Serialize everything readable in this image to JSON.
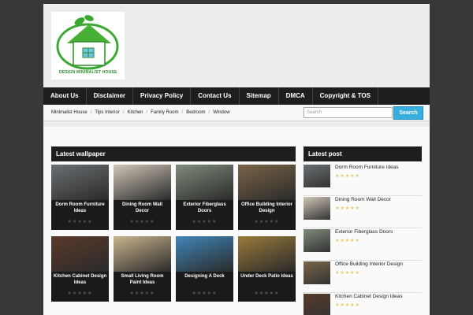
{
  "logo": {
    "text": "DESIGN MINIMALIST HOUSE",
    "colors": {
      "green": "#3aa832",
      "roof": "#47b035",
      "house": "#ffffff"
    }
  },
  "nav": {
    "items": [
      "About Us",
      "Disclaimer",
      "Privacy Policy",
      "Contact Us",
      "Sitemap",
      "DMCA",
      "Copyright & TOS"
    ]
  },
  "breadcrumbs": [
    "Minimalist House",
    "Tips Interior",
    "Kitchen",
    "Family Room",
    "Bedroom",
    "Window"
  ],
  "search": {
    "placeholder": "Search",
    "button_label": "Search"
  },
  "wallpaper": {
    "heading": "Latest wallpaper",
    "cards": [
      {
        "title": "Dorm Room Furniture Ideas",
        "stars": "★★★★★",
        "thumb_color": "#6b6f72"
      },
      {
        "title": "Dining Room Wall Decor",
        "stars": "★★★★★",
        "thumb_color": "#cfc6b6"
      },
      {
        "title": "Exterior Fiberglass Doors",
        "stars": "★★★★★",
        "thumb_color": "#7f8c7a"
      },
      {
        "title": "Office Building Interior Design",
        "stars": "★★★★★",
        "thumb_color": "#7a6448"
      },
      {
        "title": "Kitchen Cabinet Design Ideas",
        "stars": "★★★★★",
        "thumb_color": "#5a3a2a"
      },
      {
        "title": "Small Living Room Paint Ideas",
        "stars": "★★★★★",
        "thumb_color": "#c9b48c"
      },
      {
        "title": "Designing A Deck",
        "stars": "★★★★★",
        "thumb_color": "#3f86b8"
      },
      {
        "title": "Under Deck Patio Ideas",
        "stars": "★★★★★",
        "thumb_color": "#9a7a3a"
      }
    ]
  },
  "latest_post": {
    "heading": "Latest post",
    "items": [
      {
        "title": "Dorm Room Furniture Ideas",
        "stars": "★★★★★",
        "thumb_color": "#6b6f72"
      },
      {
        "title": "Dining Room Wall Decor",
        "stars": "★★★★★",
        "thumb_color": "#cfc6b6"
      },
      {
        "title": "Exterior Fiberglass Doors",
        "stars": "★★★★★",
        "thumb_color": "#7f8c7a"
      },
      {
        "title": "Office Building Interior Design",
        "stars": "★★★★★",
        "thumb_color": "#7a6448"
      },
      {
        "title": "Kitchen Cabinet Design Ideas",
        "stars": "★★★★★",
        "thumb_color": "#5a3a2a"
      }
    ]
  }
}
